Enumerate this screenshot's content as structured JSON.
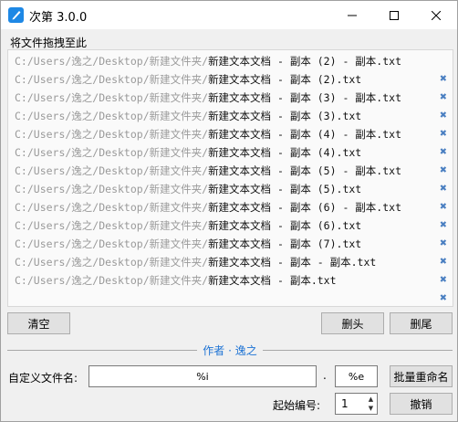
{
  "window": {
    "title": "次第 3.0.0"
  },
  "drop_label": "将文件拖拽至此",
  "files": [
    {
      "path": "C:/Users/逸之/Desktop/新建文件夹/",
      "name": "新建文本文档 - 副本 (2) - 副本.txt"
    },
    {
      "path": "C:/Users/逸之/Desktop/新建文件夹/",
      "name": "新建文本文档 - 副本 (2).txt"
    },
    {
      "path": "C:/Users/逸之/Desktop/新建文件夹/",
      "name": "新建文本文档 - 副本 (3) - 副本.txt"
    },
    {
      "path": "C:/Users/逸之/Desktop/新建文件夹/",
      "name": "新建文本文档 - 副本 (3).txt"
    },
    {
      "path": "C:/Users/逸之/Desktop/新建文件夹/",
      "name": "新建文本文档 - 副本 (4) - 副本.txt"
    },
    {
      "path": "C:/Users/逸之/Desktop/新建文件夹/",
      "name": "新建文本文档 - 副本 (4).txt"
    },
    {
      "path": "C:/Users/逸之/Desktop/新建文件夹/",
      "name": "新建文本文档 - 副本 (5) - 副本.txt"
    },
    {
      "path": "C:/Users/逸之/Desktop/新建文件夹/",
      "name": "新建文本文档 - 副本 (5).txt"
    },
    {
      "path": "C:/Users/逸之/Desktop/新建文件夹/",
      "name": "新建文本文档 - 副本 (6) - 副本.txt"
    },
    {
      "path": "C:/Users/逸之/Desktop/新建文件夹/",
      "name": "新建文本文档 - 副本 (6).txt"
    },
    {
      "path": "C:/Users/逸之/Desktop/新建文件夹/",
      "name": "新建文本文档 - 副本 (7).txt"
    },
    {
      "path": "C:/Users/逸之/Desktop/新建文件夹/",
      "name": "新建文本文档 - 副本 - 副本.txt"
    },
    {
      "path": "C:/Users/逸之/Desktop/新建文件夹/",
      "name": "新建文本文档 - 副本.txt"
    }
  ],
  "remove_icon": "close-x-icon",
  "buttons": {
    "clear": "清空",
    "trim_head": "删头",
    "trim_tail": "删尾",
    "batch_rename": "批量重命名",
    "undo": "撤销"
  },
  "author": "作者 · 逸之",
  "custom_name": {
    "label": "自定义文件名:",
    "name_value": "%i",
    "dot": ".",
    "ext_value": "%e"
  },
  "start_number": {
    "label": "起始编号:",
    "value": "1"
  },
  "colors": {
    "accent": "#1e73d4",
    "remove_icon": "#4a7fc1",
    "path_text": "#9a9a9a"
  }
}
